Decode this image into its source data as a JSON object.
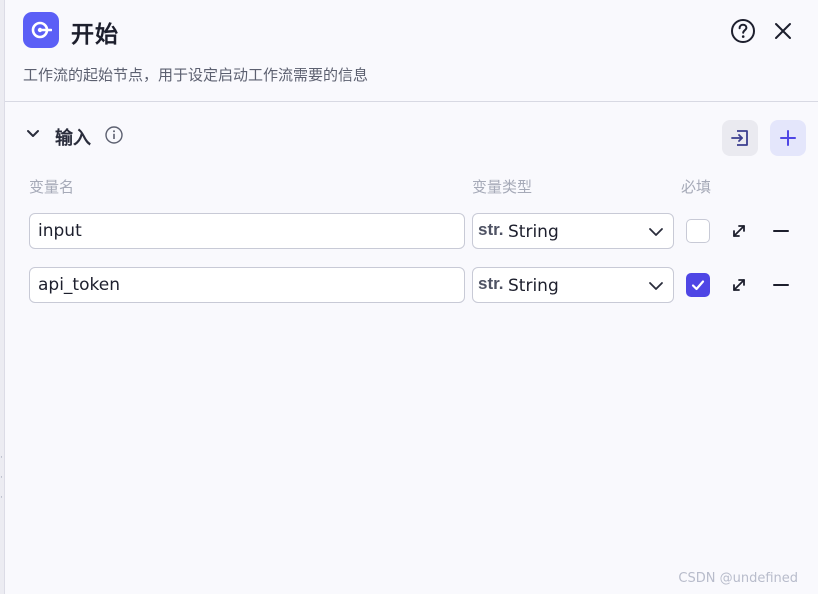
{
  "header": {
    "title": "开始",
    "description": "工作流的起始节点，用于设定启动工作流需要的信息"
  },
  "input_section": {
    "title": "输入",
    "columns": {
      "name": "变量名",
      "type": "变量类型",
      "required": "必填"
    }
  },
  "variables": [
    {
      "name": "input",
      "type_prefix": "str.",
      "type": "String",
      "required": false
    },
    {
      "name": "api_token",
      "type_prefix": "str.",
      "type": "String",
      "required": true
    }
  ],
  "watermark": "CSDN @undefined",
  "colors": {
    "accent": "#4f46e5",
    "icon_bg": "#5b5ff6"
  }
}
